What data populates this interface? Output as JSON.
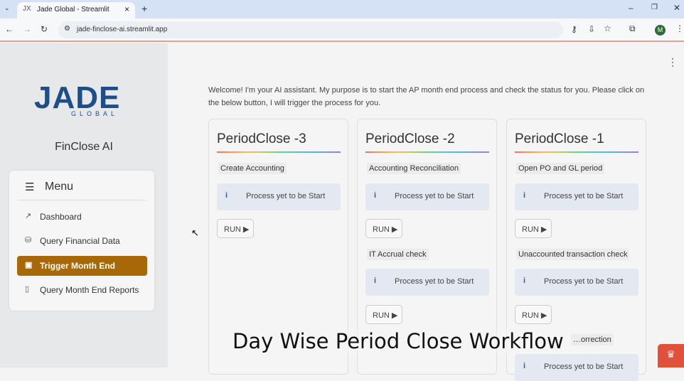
{
  "browser": {
    "tab_title": "Jade Global - Streamlit",
    "url": "jade-finclose-ai.streamlit.app",
    "profile_initial": "M"
  },
  "sidebar": {
    "logo_text": "JADE",
    "logo_sub": "GLOBAL",
    "app_name": "FinClose AI",
    "menu_title": "Menu",
    "items": [
      {
        "label": "Dashboard",
        "icon": "chart-line-icon"
      },
      {
        "label": "Query Financial Data",
        "icon": "database-icon"
      },
      {
        "label": "Trigger Month End",
        "icon": "inbox-icon",
        "active": true
      },
      {
        "label": "Query Month End Reports",
        "icon": "document-icon"
      }
    ]
  },
  "main": {
    "welcome": "Welcome! I'm your AI assistant. My purpose is to start the AP month end process and check the status for you. Please click on the below button, I will trigger the process for you.",
    "cards": [
      {
        "title": "PeriodClose -3",
        "steps": [
          {
            "name": "Create Accounting",
            "status": "Process yet to be Start",
            "button": "RUN ▶"
          }
        ]
      },
      {
        "title": "PeriodClose -2",
        "steps": [
          {
            "name": "Accounting Reconciliation",
            "status": "Process yet to be Start",
            "button": "RUN ▶"
          },
          {
            "name": "IT Accrual check",
            "status": "Process yet to be Start",
            "button": "RUN ▶"
          }
        ]
      },
      {
        "title": "PeriodClose -1",
        "steps": [
          {
            "name": "Open PO and GL period",
            "status": "Process yet to be Start",
            "button": "RUN ▶"
          },
          {
            "name": "Unaccounted transaction check",
            "status": "Process yet to be Start",
            "button": "RUN ▶"
          },
          {
            "name": "…orrection",
            "status": "Process yet to be Start"
          }
        ]
      }
    ]
  },
  "caption": "Day Wise Period Close Workflow",
  "colors": {
    "accent": "#a86808",
    "logo": "#1c4f8a",
    "badge": "#e0503a"
  }
}
